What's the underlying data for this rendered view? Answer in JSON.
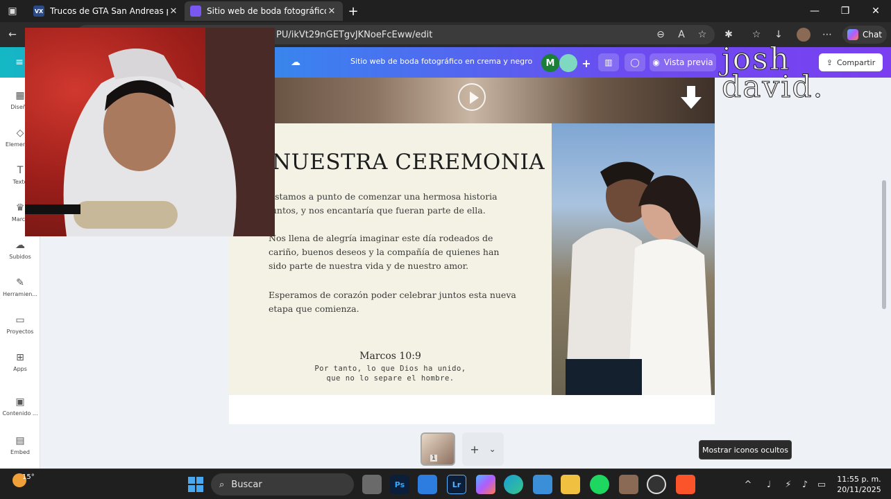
{
  "browser": {
    "tabs": [
      {
        "title": "Trucos de GTA San Andreas para l",
        "favicon": "VX"
      },
      {
        "title": "Sitio web de boda fotográfico en",
        "favicon": ""
      }
    ],
    "new_tab": "+",
    "url": "PU/ikVt29nGETgvJKNoeFcEww/edit",
    "chat_label": "Chat",
    "window_controls": {
      "minimize": "—",
      "maximize": "❐",
      "close": "✕"
    }
  },
  "canva": {
    "doc_title": "Sitio web de boda fotográfico en crema y negro",
    "collaborators": [
      {
        "initial": "M",
        "color": "#1a7f37"
      },
      {
        "initial": "",
        "color": "#7fd8c0"
      }
    ],
    "preview_label": "Vista previa",
    "share_label": "Compartir",
    "sidebar": [
      {
        "label": "Diseño",
        "icon": "layout-icon"
      },
      {
        "label": "Elementos",
        "icon": "shapes-icon"
      },
      {
        "label": "Texto",
        "icon": "text-icon"
      },
      {
        "label": "Marca",
        "icon": "brand-icon"
      },
      {
        "label": "Subidos",
        "icon": "upload-icon"
      },
      {
        "label": "Herramien...",
        "icon": "pen-icon"
      },
      {
        "label": "Proyectos",
        "icon": "folder-icon"
      },
      {
        "label": "Apps",
        "icon": "apps-icon"
      },
      {
        "label": "Contenido ...",
        "icon": "content-icon"
      },
      {
        "label": "Embed",
        "icon": "embed-icon"
      }
    ]
  },
  "design": {
    "heading": "NUESTRA CEREMONIA",
    "paragraphs": [
      "Estamos a punto de comenzar una hermosa historia juntos, y nos encantaría que fueran parte de ella.",
      "Nos llena de alegría imaginar este día rodeados de cariño, buenos deseos y la compañía de quienes han sido parte de nuestra vida y de nuestro amor.",
      "Esperamos de corazón poder celebrar juntos esta nueva etapa que comienza."
    ],
    "verse_ref": "Marcos 10:9",
    "verse_lines": [
      "Por tanto, lo que Dios ha unido,",
      "que no lo separe el hombre."
    ]
  },
  "page_controls": {
    "page_number": "1",
    "add": "+",
    "chevron": "⌄"
  },
  "tooltip": "Mostrar iconos ocultos",
  "watermark": [
    "josh",
    "david."
  ],
  "taskbar": {
    "weather_temp": "15°",
    "search_placeholder": "Buscar",
    "apps": [
      "Ps",
      "Lr"
    ],
    "time": "11:55 p. m.",
    "date": "20/11/2025"
  }
}
